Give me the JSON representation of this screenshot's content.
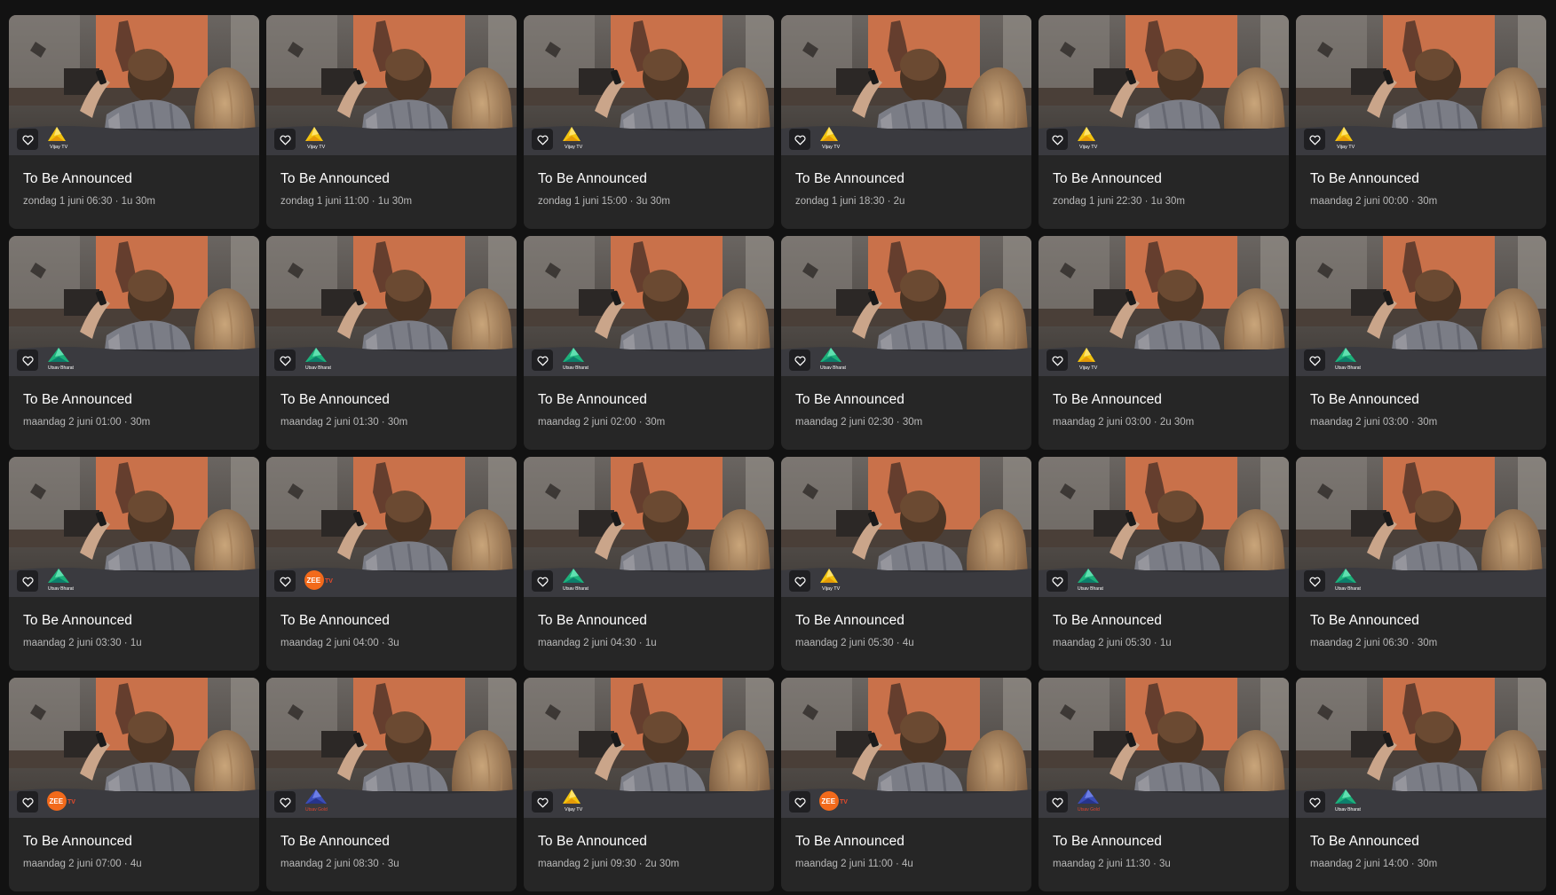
{
  "program_cards": [
    {
      "title": "To Be Announced",
      "meta": "zondag 1 juni 06:30 · 1u 30m",
      "channel": "Vijay TV",
      "channel_logo": "vijay-tv-logo"
    },
    {
      "title": "To Be Announced",
      "meta": "zondag 1 juni 11:00 · 1u 30m",
      "channel": "Vijay TV",
      "channel_logo": "vijay-tv-logo"
    },
    {
      "title": "To Be Announced",
      "meta": "zondag 1 juni 15:00 · 3u 30m",
      "channel": "Vijay TV",
      "channel_logo": "vijay-tv-logo"
    },
    {
      "title": "To Be Announced",
      "meta": "zondag 1 juni 18:30 · 2u",
      "channel": "Vijay TV",
      "channel_logo": "vijay-tv-logo"
    },
    {
      "title": "To Be Announced",
      "meta": "zondag 1 juni 22:30 · 1u 30m",
      "channel": "Vijay TV",
      "channel_logo": "vijay-tv-logo"
    },
    {
      "title": "To Be Announced",
      "meta": "maandag 2 juni 00:00 · 30m",
      "channel": "Vijay TV",
      "channel_logo": "vijay-tv-logo"
    },
    {
      "title": "To Be Announced",
      "meta": "maandag 2 juni 01:00 · 30m",
      "channel": "Utsav Bharat",
      "channel_logo": "utsav-bharat-logo"
    },
    {
      "title": "To Be Announced",
      "meta": "maandag 2 juni 01:30 · 30m",
      "channel": "Utsav Bharat",
      "channel_logo": "utsav-bharat-logo"
    },
    {
      "title": "To Be Announced",
      "meta": "maandag 2 juni 02:00 · 30m",
      "channel": "Utsav Bharat",
      "channel_logo": "utsav-bharat-logo"
    },
    {
      "title": "To Be Announced",
      "meta": "maandag 2 juni 02:30 · 30m",
      "channel": "Utsav Bharat",
      "channel_logo": "utsav-bharat-logo"
    },
    {
      "title": "To Be Announced",
      "meta": "maandag 2 juni 03:00 · 2u 30m",
      "channel": "Vijay TV",
      "channel_logo": "vijay-tv-logo"
    },
    {
      "title": "To Be Announced",
      "meta": "maandag 2 juni 03:00 · 30m",
      "channel": "Utsav Bharat",
      "channel_logo": "utsav-bharat-logo"
    },
    {
      "title": "To Be Announced",
      "meta": "maandag 2 juni 03:30 · 1u",
      "channel": "Utsav Bharat",
      "channel_logo": "utsav-bharat-logo"
    },
    {
      "title": "To Be Announced",
      "meta": "maandag 2 juni 04:00 · 3u",
      "channel": "ZEE TV",
      "channel_logo": "zee-tv-logo"
    },
    {
      "title": "To Be Announced",
      "meta": "maandag 2 juni 04:30 · 1u",
      "channel": "Utsav Bharat",
      "channel_logo": "utsav-bharat-logo"
    },
    {
      "title": "To Be Announced",
      "meta": "maandag 2 juni 05:30 · 4u",
      "channel": "Vijay TV",
      "channel_logo": "vijay-tv-logo"
    },
    {
      "title": "To Be Announced",
      "meta": "maandag 2 juni 05:30 · 1u",
      "channel": "Utsav Bharat",
      "channel_logo": "utsav-bharat-logo"
    },
    {
      "title": "To Be Announced",
      "meta": "maandag 2 juni 06:30 · 30m",
      "channel": "Utsav Bharat",
      "channel_logo": "utsav-bharat-logo"
    },
    {
      "title": "To Be Announced",
      "meta": "maandag 2 juni 07:00 · 4u",
      "channel": "ZEE TV",
      "channel_logo": "zee-tv-logo"
    },
    {
      "title": "To Be Announced",
      "meta": "maandag 2 juni 08:30 · 3u",
      "channel": "Utsav Gold",
      "channel_logo": "utsav-gold-logo"
    },
    {
      "title": "To Be Announced",
      "meta": "maandag 2 juni 09:30 · 2u 30m",
      "channel": "Vijay TV",
      "channel_logo": "vijay-tv-logo"
    },
    {
      "title": "To Be Announced",
      "meta": "maandag 2 juni 11:00 · 4u",
      "channel": "ZEE TV",
      "channel_logo": "zee-tv-logo"
    },
    {
      "title": "To Be Announced",
      "meta": "maandag 2 juni 11:30 · 3u",
      "channel": "Utsav Gold",
      "channel_logo": "utsav-gold-logo"
    },
    {
      "title": "To Be Announced",
      "meta": "maandag 2 juni 14:00 · 30m",
      "channel": "Utsav Bharat",
      "channel_logo": "utsav-bharat-logo"
    }
  ],
  "icons": {
    "favorite": "heart-outline-icon"
  },
  "colors": {
    "background": "#121212",
    "card": "#262626",
    "title_text": "#ffffff",
    "meta_text": "#b8b8b8"
  }
}
